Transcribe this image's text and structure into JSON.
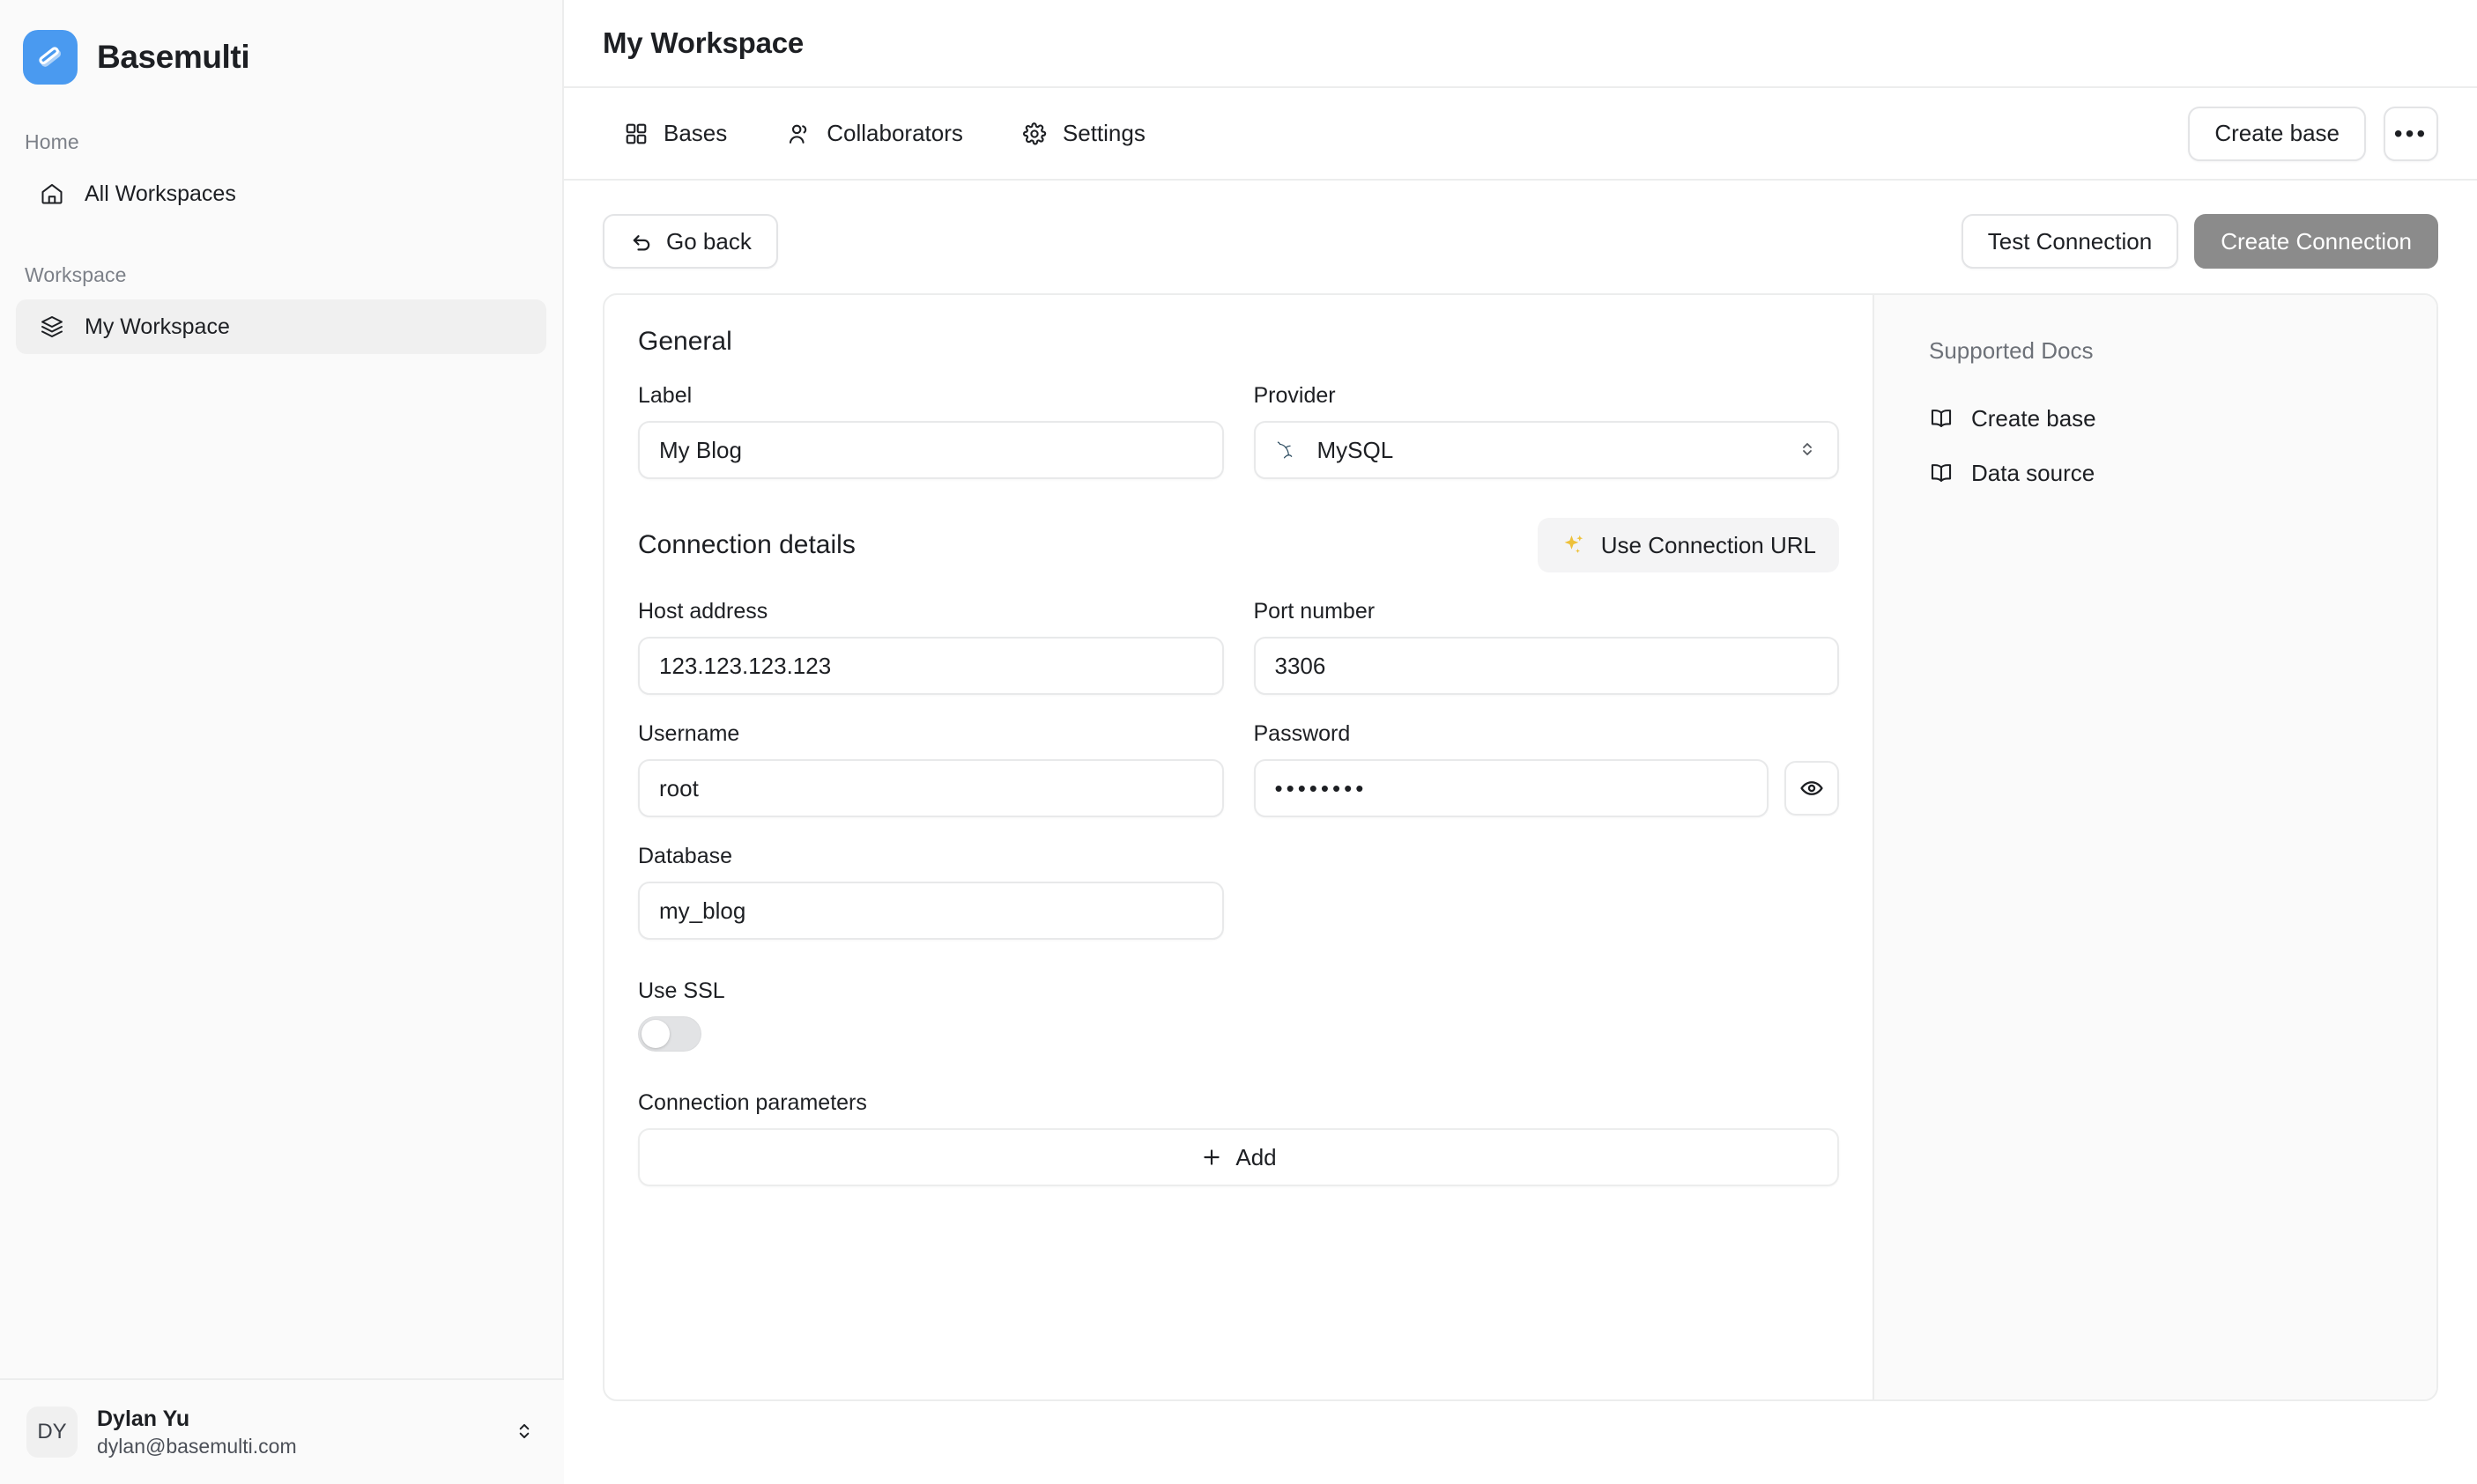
{
  "brand": {
    "name": "Basemulti",
    "logo_icon": "basemulti-logo-icon",
    "accent_color": "#4a9af0"
  },
  "sidebar": {
    "sections": [
      {
        "label": "Home",
        "items": [
          {
            "label": "All Workspaces",
            "icon": "home-icon",
            "active": false
          }
        ]
      },
      {
        "label": "Workspace",
        "items": [
          {
            "label": "My Workspace",
            "icon": "layers-icon",
            "active": true
          }
        ]
      }
    ],
    "user": {
      "initials": "DY",
      "name": "Dylan Yu",
      "email": "dylan@basemulti.com",
      "chevron_icon": "chevron-up-down-icon"
    }
  },
  "header": {
    "title": "My Workspace",
    "tabs": [
      {
        "label": "Bases",
        "icon": "grid-icon"
      },
      {
        "label": "Collaborators",
        "icon": "users-icon"
      },
      {
        "label": "Settings",
        "icon": "gear-icon"
      }
    ],
    "create_base_label": "Create base",
    "more_label": "•••",
    "more_icon": "ellipsis-icon"
  },
  "actions": {
    "go_back_label": "Go back",
    "go_back_icon": "arrow-undo-icon",
    "test_connection_label": "Test Connection",
    "create_connection_label": "Create Connection",
    "create_connection_disabled": true,
    "create_connection_bg": "#8b8b8b"
  },
  "form": {
    "general_title": "General",
    "label_field": {
      "label": "Label",
      "value": "My Blog",
      "placeholder": "Label"
    },
    "provider_field": {
      "label": "Provider",
      "value": "MySQL",
      "icon": "mysql-dolphin-icon",
      "caret_icon": "chevron-up-down-icon"
    },
    "connection_title": "Connection details",
    "use_connection_url_label": "Use Connection URL",
    "use_connection_url_icon": "sparkle-icon",
    "sparkle_color": "#eec13a",
    "host_field": {
      "label": "Host address",
      "value": "123.123.123.123",
      "placeholder": "Host address"
    },
    "port_field": {
      "label": "Port number",
      "value": "3306",
      "placeholder": "Port number"
    },
    "username_field": {
      "label": "Username",
      "value": "root",
      "placeholder": "Username"
    },
    "password_field": {
      "label": "Password",
      "value": "••••••••",
      "placeholder": "Password",
      "reveal_icon": "eye-icon"
    },
    "database_field": {
      "label": "Database",
      "value": "my_blog",
      "placeholder": "Database"
    },
    "use_ssl": {
      "label": "Use SSL",
      "enabled": false
    },
    "connection_parameters": {
      "label": "Connection parameters",
      "add_label": "Add",
      "add_icon": "plus-icon"
    }
  },
  "aside": {
    "title": "Supported Docs",
    "links": [
      {
        "label": "Create base",
        "icon": "book-icon"
      },
      {
        "label": "Data source",
        "icon": "book-icon"
      }
    ]
  }
}
